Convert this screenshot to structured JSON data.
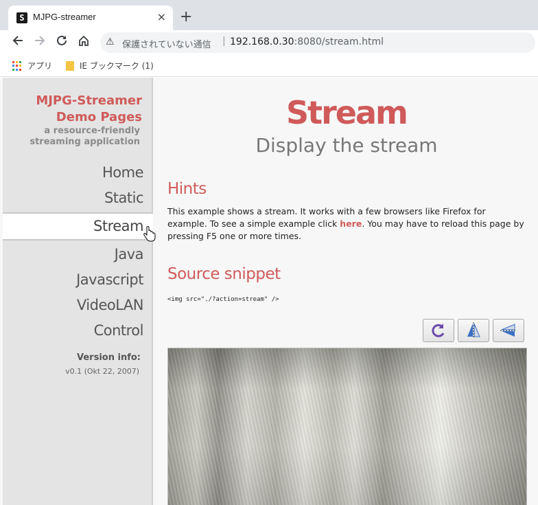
{
  "browser": {
    "tab_title": "MJPG-streamer",
    "tab_close": "×",
    "new_tab": "+",
    "insecure_label": "保護されていない通信",
    "separator": "|",
    "url_host": "192.168.0.30",
    "url_rest": ":8080/stream.html",
    "bookmarks": [
      {
        "label": "アプリ"
      },
      {
        "label": "IE ブックマーク (1)"
      }
    ]
  },
  "sidebar": {
    "brand_line1": "MJPG-Streamer",
    "brand_line2": "Demo Pages",
    "tagline": "a resource-friendly streaming application",
    "menu": [
      {
        "label": "Home",
        "active": false
      },
      {
        "label": "Static",
        "active": false
      },
      {
        "label": "Stream",
        "active": true
      },
      {
        "label": "Java",
        "active": false
      },
      {
        "label": "Javascript",
        "active": false
      },
      {
        "label": "VideoLAN",
        "active": false
      },
      {
        "label": "Control",
        "active": false
      }
    ],
    "version_title": "Version info:",
    "version_value": "v0.1 (Okt 22, 2007)"
  },
  "main": {
    "title": "Stream",
    "subtitle": "Display the stream",
    "hints_heading": "Hints",
    "hints_text_1": "This example shows a stream. It works with a few browsers like Firefox for example. To see a simple example click ",
    "hints_link": "here",
    "hints_text_2": ". You may have to reload this page by pressing F5 one or more times.",
    "source_heading": "Source snippet",
    "source_code": "<img src=\"./?action=stream\" />",
    "buttons": [
      {
        "icon": "rotate-icon"
      },
      {
        "icon": "flip-vertical-icon"
      },
      {
        "icon": "flip-horizontal-icon"
      }
    ]
  },
  "colors": {
    "accent": "#d05a5a",
    "sidebar_bg": "#e4e4e4",
    "page_bg": "#f7f7f7"
  }
}
